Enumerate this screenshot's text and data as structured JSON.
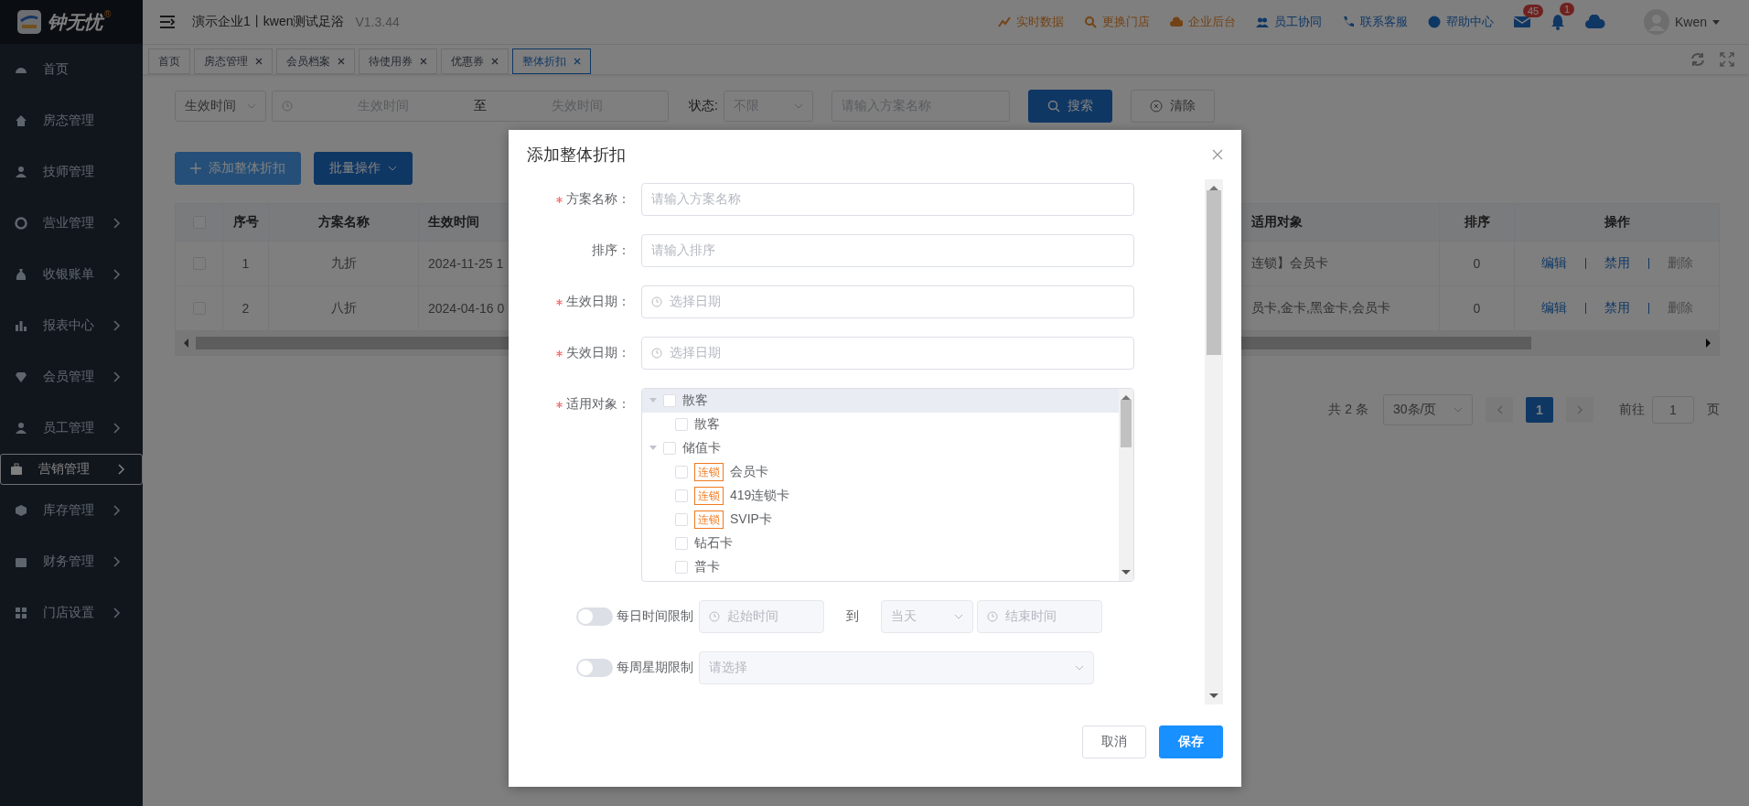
{
  "header": {
    "logo_text": "钟无忧",
    "logo_mark": "®",
    "company": "演示企业1丨kwen测试足浴",
    "version": "V1.3.44",
    "links": [
      {
        "label": "实时数据",
        "kind": "accent"
      },
      {
        "label": "更换门店",
        "kind": "accent"
      },
      {
        "label": "企业后台",
        "kind": "accent"
      },
      {
        "label": "员工协同",
        "kind": "plain"
      },
      {
        "label": "联系客服",
        "kind": "plain"
      },
      {
        "label": "帮助中心",
        "kind": "plain"
      }
    ],
    "mail_badge": "45",
    "bell_badge": "1",
    "user": "Kwen"
  },
  "sidebar": {
    "items": [
      {
        "label": "首页",
        "has_submenu": false,
        "selected": false
      },
      {
        "label": "房态管理",
        "has_submenu": false,
        "selected": false
      },
      {
        "label": "技师管理",
        "has_submenu": false,
        "selected": false
      },
      {
        "label": "营业管理",
        "has_submenu": true,
        "selected": false
      },
      {
        "label": "收银账单",
        "has_submenu": true,
        "selected": false
      },
      {
        "label": "报表中心",
        "has_submenu": true,
        "selected": false
      },
      {
        "label": "会员管理",
        "has_submenu": true,
        "selected": false
      },
      {
        "label": "员工管理",
        "has_submenu": true,
        "selected": false
      },
      {
        "label": "营销管理",
        "has_submenu": true,
        "selected": true
      },
      {
        "label": "库存管理",
        "has_submenu": true,
        "selected": false
      },
      {
        "label": "财务管理",
        "has_submenu": true,
        "selected": false
      },
      {
        "label": "门店设置",
        "has_submenu": true,
        "selected": false
      }
    ]
  },
  "tabs": [
    {
      "label": "首页",
      "closable": false,
      "selected": false
    },
    {
      "label": "房态管理",
      "closable": true,
      "selected": false
    },
    {
      "label": "会员档案",
      "closable": true,
      "selected": false
    },
    {
      "label": "待使用券",
      "closable": true,
      "selected": false
    },
    {
      "label": "优惠券",
      "closable": true,
      "selected": false
    },
    {
      "label": "整体折扣",
      "closable": true,
      "selected": true
    }
  ],
  "filters": {
    "time_type": "生效时间",
    "start_placeholder": "生效时间",
    "to": "至",
    "end_placeholder": "失效时间",
    "status_label": "状态:",
    "status_value": "不限",
    "name_placeholder": "请输入方案名称",
    "search": "搜索",
    "clear": "清除"
  },
  "toolbar": {
    "add": "添加整体折扣",
    "batch": "批量操作"
  },
  "table": {
    "all_checked": false,
    "columns": [
      "序号",
      "方案名称",
      "生效时间",
      "适用对象",
      "排序",
      "操作"
    ],
    "rows": [
      {
        "checked": false,
        "no": "1",
        "name": "九折",
        "start": "2024-11-25 1",
        "target": "连锁】会员卡",
        "sort": "0",
        "actions": [
          {
            "label": "编辑",
            "disabled": false
          },
          {
            "label": "禁用",
            "disabled": false
          },
          {
            "label": "删除",
            "disabled": true
          }
        ]
      },
      {
        "checked": false,
        "no": "2",
        "name": "八折",
        "start": "2024-04-16 0",
        "target": "员卡,金卡,黑金卡,会员卡",
        "sort": "0",
        "actions": [
          {
            "label": "编辑",
            "disabled": false
          },
          {
            "label": "禁用",
            "disabled": false
          },
          {
            "label": "删除",
            "disabled": true
          }
        ]
      }
    ]
  },
  "pagination": {
    "total": "共 2 条",
    "page_size": "30条/页",
    "pages": [
      {
        "label": "1",
        "selected": true
      }
    ],
    "goto_label": "前往",
    "goto_value": "1",
    "unit": "页"
  },
  "dialog": {
    "title": "添加整体折扣",
    "fields": [
      {
        "kind": "text",
        "label": "方案名称：",
        "required": true,
        "placeholder": "请输入方案名称"
      },
      {
        "kind": "text",
        "label": "排序：",
        "required": false,
        "placeholder": "请输入排序"
      },
      {
        "kind": "date",
        "label": "生效日期：",
        "required": true,
        "placeholder": "选择日期"
      },
      {
        "kind": "date",
        "label": "失效日期：",
        "required": true,
        "placeholder": "选择日期"
      },
      {
        "kind": "tree",
        "label": "适用对象：",
        "required": true,
        "nodes": [
          {
            "label": "散客",
            "checked": false,
            "expanded": true,
            "selected": true,
            "children": [
              {
                "label": "散客",
                "checked": false,
                "selected": false
              }
            ]
          },
          {
            "label": "储值卡",
            "checked": false,
            "expanded": true,
            "selected": false,
            "children": [
              {
                "label": "会员卡",
                "tag": "连锁",
                "checked": false,
                "selected": false
              },
              {
                "label": "419连锁卡",
                "tag": "连锁",
                "checked": false,
                "selected": false
              },
              {
                "label": "SVIP卡",
                "tag": "连锁",
                "checked": false,
                "selected": false
              },
              {
                "label": "钻石卡",
                "checked": false,
                "selected": false
              },
              {
                "label": "普卡",
                "checked": false,
                "selected": false
              }
            ]
          }
        ]
      }
    ],
    "limits": [
      {
        "kind": "time_range",
        "label": "每日时间限制",
        "on": false,
        "start_placeholder": "起始时间",
        "to": "到",
        "day": "当天",
        "end_placeholder": "结束时间"
      },
      {
        "kind": "select",
        "label": "每周星期限制",
        "on": false,
        "placeholder": "请选择"
      }
    ],
    "cancel": "取消",
    "save": "保存"
  }
}
